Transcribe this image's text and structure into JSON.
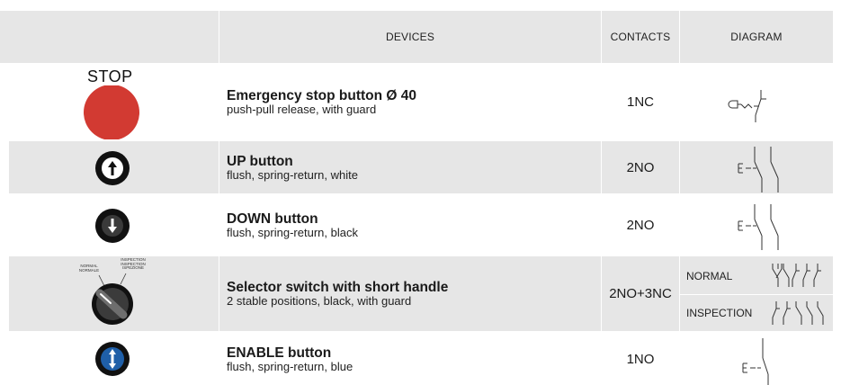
{
  "header": {
    "devices": "DEVICES",
    "contacts": "CONTACTS",
    "diagram": "DIAGRAM"
  },
  "rows": [
    {
      "title": "Emergency stop button Ø 40",
      "subtitle": "push-pull release, with guard",
      "contacts": "1NC",
      "icon_label": "STOP",
      "icon": "emergency-stop-red-button"
    },
    {
      "title": "UP button",
      "subtitle": "flush, spring-return, white",
      "contacts": "2NO",
      "icon": "arrow-up-button"
    },
    {
      "title": "DOWN button",
      "subtitle": "flush, spring-return, black",
      "contacts": "2NO",
      "icon": "arrow-down-button"
    },
    {
      "title": "Selector switch with short handle",
      "subtitle": "2 stable positions, black, with guard",
      "contacts": "2NO+3NC",
      "icon": "selector-switch",
      "selector_labels": {
        "left_1": "NORMAL",
        "left_2": "NORMALE",
        "right_1": "INSPECTION",
        "right_2": "INSPECTION",
        "right_3": "ISPEZIONE"
      },
      "diagram_labels": {
        "normal": "NORMAL",
        "inspection": "INSPECTION"
      }
    },
    {
      "title": "ENABLE button",
      "subtitle": "flush, spring-return, blue",
      "contacts": "1NO",
      "icon": "arrow-updown-blue-button"
    }
  ],
  "colors": {
    "header_bg": "#e6e6e6",
    "row_grey": "#e6e6e6",
    "stop_red": "#d23a32",
    "enable_blue": "#1f5fa8"
  }
}
